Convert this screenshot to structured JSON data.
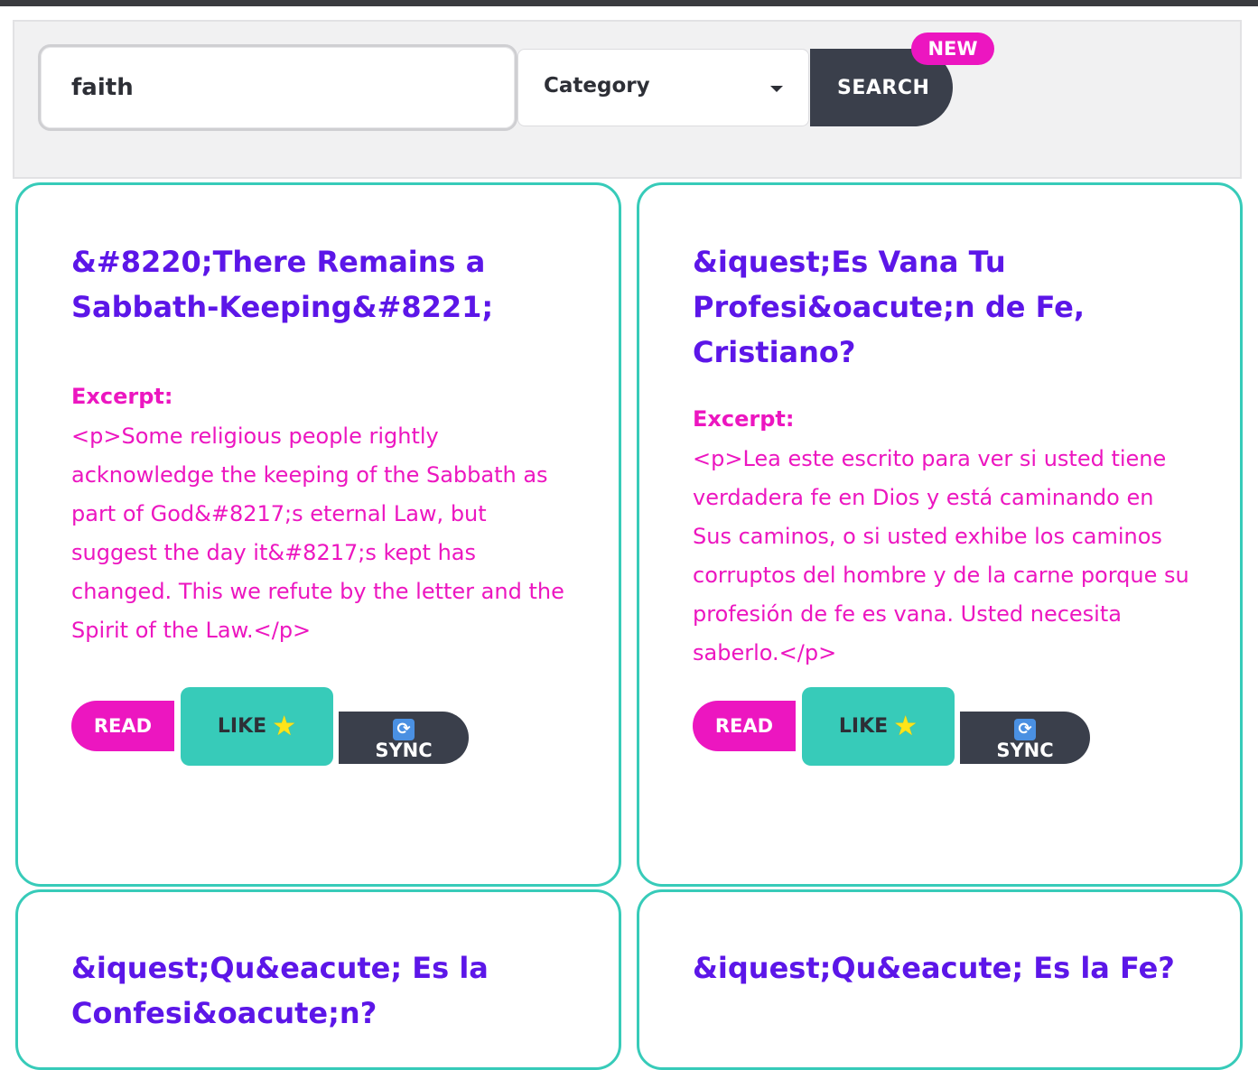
{
  "search": {
    "query": "faith",
    "category_label": "Category",
    "button_label": "SEARCH",
    "badge": "NEW"
  },
  "cards": [
    {
      "title": "&#8220;There Remains a Sabbath-Keeping&#8221;",
      "excerpt_label": "Excerpt:",
      "excerpt": "<p>Some religious people rightly acknowledge the keeping of the Sabbath as part of God&#8217;s eternal Law, but suggest the day it&#8217;s kept has changed. This we refute by the letter and the Spirit of the Law.</p>",
      "read_label": "READ",
      "like_label": "LIKE",
      "sync_label": "SYNC"
    },
    {
      "title": "&iquest;Es Vana Tu Profesi&oacute;n de Fe, Cristiano?",
      "excerpt_label": "Excerpt:",
      "excerpt": "<p>Lea este escrito para ver si usted tiene verdadera fe en Dios y está caminando en Sus caminos, o si usted exhibe los caminos corruptos del hombre y de la carne porque su profesión de fe es vana. Usted necesita saberlo.</p>",
      "read_label": "READ",
      "like_label": "LIKE",
      "sync_label": "SYNC"
    },
    {
      "title": "&iquest;Qu&eacute; Es la Confesi&oacute;n?"
    },
    {
      "title": "&iquest;Qu&eacute; Es la Fe?"
    }
  ],
  "icons": {
    "like": "star-icon",
    "sync": "sync-icon"
  },
  "colors": {
    "accent_teal": "#37cbb9",
    "accent_pink": "#ec16c0",
    "title_purple": "#5c16e8",
    "dark_button": "#3a3f4b"
  }
}
